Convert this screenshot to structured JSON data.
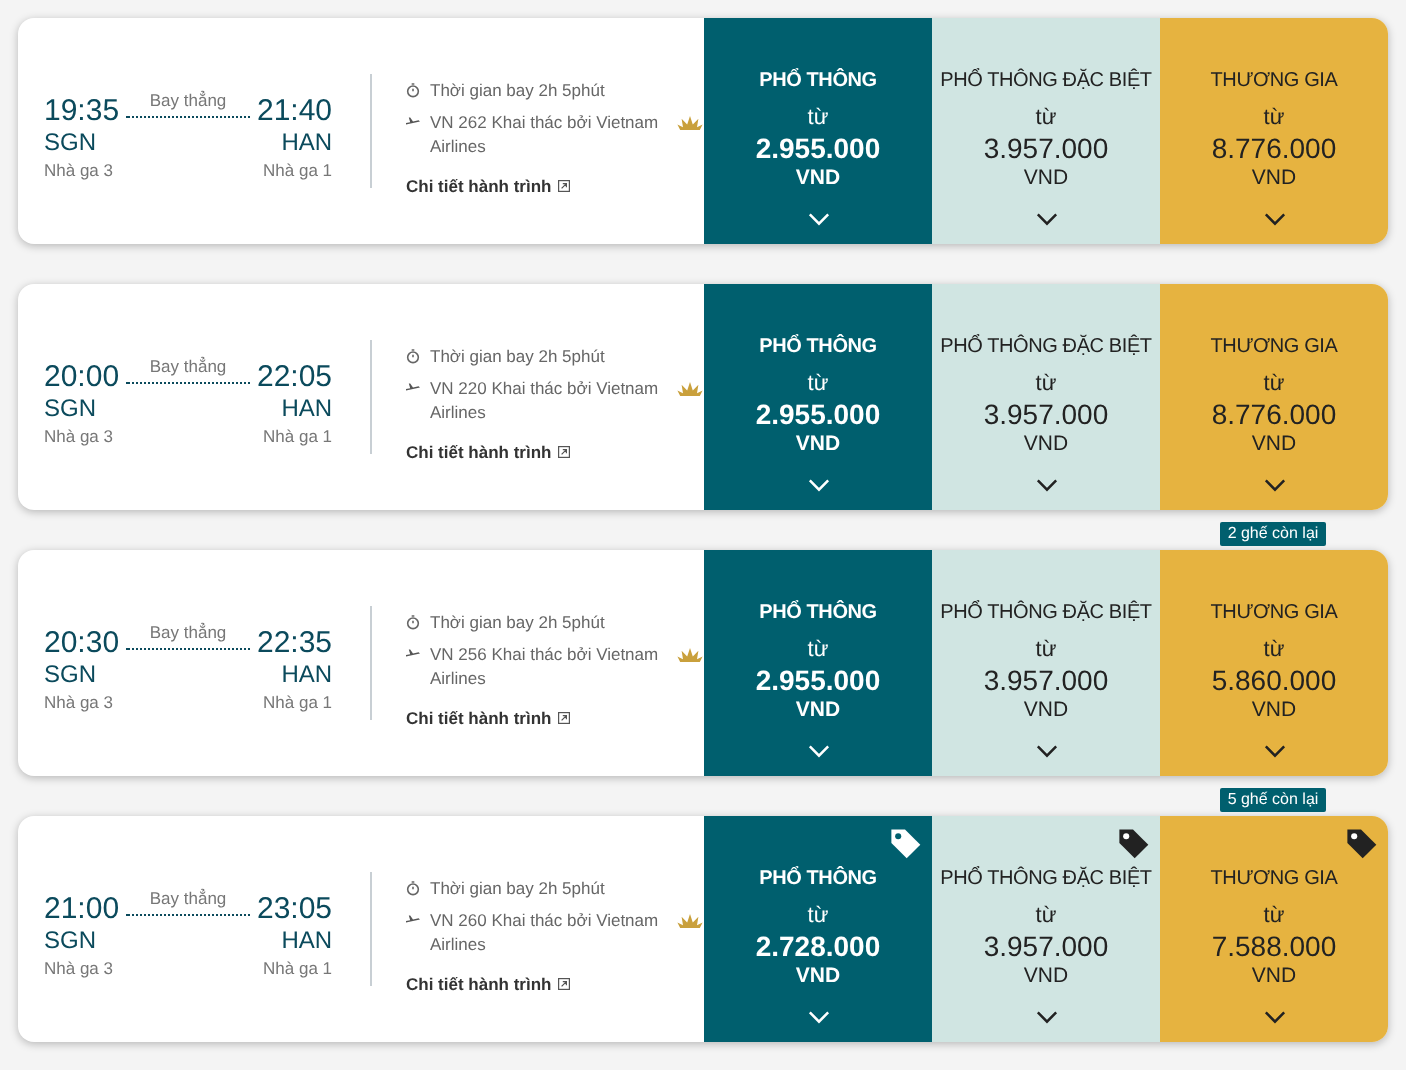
{
  "flights": [
    {
      "depart_time": "19:35",
      "depart_code": "SGN",
      "depart_terminal": "Nhà ga 3",
      "stop_label": "Bay thẳng",
      "arrive_time": "21:40",
      "arrive_code": "HAN",
      "arrive_terminal": "Nhà ga 1",
      "duration": "Thời gian bay 2h 5phút",
      "flight_info": "VN 262 Khai thác bởi Vietnam Airlines",
      "details_link": "Chi tiết hành trình",
      "fares": [
        {
          "kind": "economy",
          "title": "PHỔ THÔNG",
          "from": "từ",
          "price": "2.955.000",
          "currency": "VND",
          "promo": false
        },
        {
          "kind": "premium",
          "title": "PHỔ THÔNG ĐẶC BIỆT",
          "from": "từ",
          "price": "3.957.000",
          "currency": "VND",
          "promo": false
        },
        {
          "kind": "business",
          "title": "THƯƠNG GIA",
          "from": "từ",
          "price": "8.776.000",
          "currency": "VND",
          "promo": false
        }
      ]
    },
    {
      "depart_time": "20:00",
      "depart_code": "SGN",
      "depart_terminal": "Nhà ga 3",
      "stop_label": "Bay thẳng",
      "arrive_time": "22:05",
      "arrive_code": "HAN",
      "arrive_terminal": "Nhà ga 1",
      "duration": "Thời gian bay 2h 5phút",
      "flight_info": "VN 220 Khai thác bởi Vietnam Airlines",
      "details_link": "Chi tiết hành trình",
      "fares": [
        {
          "kind": "economy",
          "title": "PHỔ THÔNG",
          "from": "từ",
          "price": "2.955.000",
          "currency": "VND",
          "promo": false
        },
        {
          "kind": "premium",
          "title": "PHỔ THÔNG ĐẶC BIỆT",
          "from": "từ",
          "price": "3.957.000",
          "currency": "VND",
          "promo": false
        },
        {
          "kind": "business",
          "title": "THƯƠNG GIA",
          "from": "từ",
          "price": "8.776.000",
          "currency": "VND",
          "promo": false
        }
      ]
    },
    {
      "depart_time": "20:30",
      "depart_code": "SGN",
      "depart_terminal": "Nhà ga 3",
      "stop_label": "Bay thẳng",
      "arrive_time": "22:35",
      "arrive_code": "HAN",
      "arrive_terminal": "Nhà ga 1",
      "duration": "Thời gian bay 2h 5phút",
      "flight_info": "VN 256 Khai thác bởi Vietnam Airlines",
      "details_link": "Chi tiết hành trình",
      "seats_left": "2 ghế còn lại",
      "fares": [
        {
          "kind": "economy",
          "title": "PHỔ THÔNG",
          "from": "từ",
          "price": "2.955.000",
          "currency": "VND",
          "promo": false
        },
        {
          "kind": "premium",
          "title": "PHỔ THÔNG ĐẶC BIỆT",
          "from": "từ",
          "price": "3.957.000",
          "currency": "VND",
          "promo": false
        },
        {
          "kind": "business",
          "title": "THƯƠNG GIA",
          "from": "từ",
          "price": "5.860.000",
          "currency": "VND",
          "promo": false
        }
      ]
    },
    {
      "depart_time": "21:00",
      "depart_code": "SGN",
      "depart_terminal": "Nhà ga 3",
      "stop_label": "Bay thẳng",
      "arrive_time": "23:05",
      "arrive_code": "HAN",
      "arrive_terminal": "Nhà ga 1",
      "duration": "Thời gian bay 2h 5phút",
      "flight_info": "VN 260 Khai thác bởi Vietnam Airlines",
      "details_link": "Chi tiết hành trình",
      "seats_left": "5 ghế còn lại",
      "fares": [
        {
          "kind": "economy",
          "title": "PHỔ THÔNG",
          "from": "từ",
          "price": "2.728.000",
          "currency": "VND",
          "promo": true
        },
        {
          "kind": "premium",
          "title": "PHỔ THÔNG ĐẶC BIỆT",
          "from": "từ",
          "price": "3.957.000",
          "currency": "VND",
          "promo": true
        },
        {
          "kind": "business",
          "title": "THƯƠNG GIA",
          "from": "từ",
          "price": "7.588.000",
          "currency": "VND",
          "promo": true
        }
      ]
    }
  ]
}
